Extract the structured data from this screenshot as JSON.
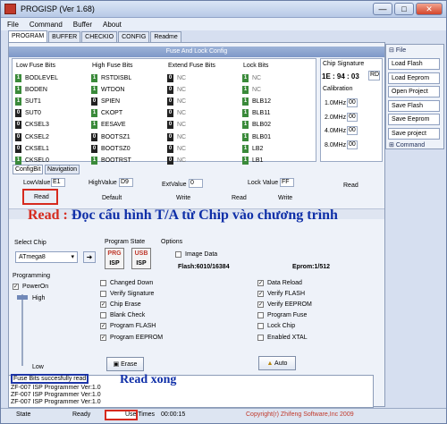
{
  "window": {
    "title": "PROGISP (Ver 1.68)",
    "minimize": "—",
    "restore": "□",
    "close": "✕"
  },
  "menu": [
    "File",
    "Command",
    "Buffer",
    "About"
  ],
  "tabs": [
    "PROGRAM",
    "BUFFER",
    "CHECKIO",
    "CONFIG",
    "Readme"
  ],
  "fuse": {
    "section_title": "Fuse And Lock Config",
    "columns": [
      "Low Fuse Bits",
      "High Fuse Bits",
      "Extend Fuse Bits",
      "Lock Bits"
    ],
    "low": [
      [
        "1",
        "BODLEVEL"
      ],
      [
        "1",
        "BODEN"
      ],
      [
        "1",
        "SUT1"
      ],
      [
        "0",
        "SUT0"
      ],
      [
        "0",
        "CKSEL3"
      ],
      [
        "0",
        "CKSEL2"
      ],
      [
        "0",
        "CKSEL1"
      ],
      [
        "1",
        "CKSEL0"
      ]
    ],
    "high": [
      [
        "1",
        "RSTDISBL"
      ],
      [
        "1",
        "WTDON"
      ],
      [
        "0",
        "SPIEN"
      ],
      [
        "1",
        "CKOPT"
      ],
      [
        "1",
        "EESAVE"
      ],
      [
        "0",
        "BOOTSZ1"
      ],
      [
        "0",
        "BOOTSZ0"
      ],
      [
        "1",
        "BOOTRST"
      ]
    ],
    "extend": [
      [
        "0",
        "NC"
      ],
      [
        "0",
        "NC"
      ],
      [
        "0",
        "NC"
      ],
      [
        "0",
        "NC"
      ],
      [
        "0",
        "NC"
      ],
      [
        "0",
        "NC"
      ],
      [
        "0",
        "NC"
      ],
      [
        "0",
        "NC"
      ]
    ],
    "lock": [
      [
        "1",
        "NC"
      ],
      [
        "1",
        "NC"
      ],
      [
        "1",
        "BLB12"
      ],
      [
        "1",
        "BLB11"
      ],
      [
        "1",
        "BLB02"
      ],
      [
        "1",
        "BLB01"
      ],
      [
        "1",
        "LB2"
      ],
      [
        "1",
        "LB1"
      ]
    ]
  },
  "chip_signature": {
    "label": "Chip Signature",
    "value": "1E : 94 : 03",
    "rd": "RD",
    "calibration": "Calibration",
    "rows": [
      [
        "1.0MHz",
        "00"
      ],
      [
        "2.0MHz",
        "00"
      ],
      [
        "4.0MHz",
        "00"
      ],
      [
        "8.0MHz",
        "00"
      ]
    ]
  },
  "subtabs": [
    "ConfigBit",
    "Navigation"
  ],
  "values": {
    "low_label": "LowValue",
    "low": "E1",
    "high_label": "HighValue",
    "high": "D9",
    "ext_label": "ExtValue",
    "ext": "0",
    "lock_label": "Lock Value",
    "lock": "FF"
  },
  "buttons": {
    "read": "Read",
    "default": "Default",
    "write": "Write",
    "read2": "Read",
    "write2": "Write",
    "read3": "Read",
    "erase": "Erase",
    "auto": "Auto"
  },
  "annotation": {
    "prefix": "Read :",
    "text": "Đọc cấu hình T/A từ Chip vào chương trình"
  },
  "select_chip": {
    "label": "Select Chip",
    "value": "ATmega8"
  },
  "program_state": {
    "label": "Program State",
    "prg": "PRG",
    "usb": "USB",
    "isp": "ISP"
  },
  "options": {
    "label": "Options",
    "image_data": "Image Data",
    "flash": "Flash:6010/16384",
    "eprom": "Eprom:1/512"
  },
  "programming": {
    "label": "Programming",
    "poweron": "PowerOn",
    "high": "High",
    "low": "Low"
  },
  "checks_left": [
    [
      "Changed Down",
      false
    ],
    [
      "Verify Signature",
      false
    ],
    [
      "Chip Erase",
      true
    ],
    [
      "Blank Check",
      false
    ],
    [
      "Program FLASH",
      true
    ],
    [
      "Program EEPROM",
      true
    ]
  ],
  "checks_right": [
    [
      "Data Reload",
      true
    ],
    [
      "Verify FLASH",
      true
    ],
    [
      "Verify EEPROM",
      true
    ],
    [
      "Program Fuse",
      false
    ],
    [
      "Lock Chip",
      false
    ],
    [
      "Enabled XTAL",
      false
    ]
  ],
  "side": {
    "file_label": "File",
    "items": [
      "Load Flash",
      "Load Eeprom",
      "Open Project",
      "Save Flash",
      "Save Eeprom",
      "Save project"
    ],
    "command_label": "Command"
  },
  "log": [
    "Fuse Bits succesfully read",
    "ZF-007 ISP Programmer Ver:1.0",
    "ZF-007 ISP Programmer Ver:1.0",
    "ZF-007 ISP Programmer Ver:1.0"
  ],
  "read_done": "Read xong",
  "status": {
    "state_label": "State",
    "state": "Ready",
    "use_times_label": "Use Times",
    "time": "00:00:15",
    "copyright": "Copyright(r) Zhifeng Software,Inc 2009"
  }
}
